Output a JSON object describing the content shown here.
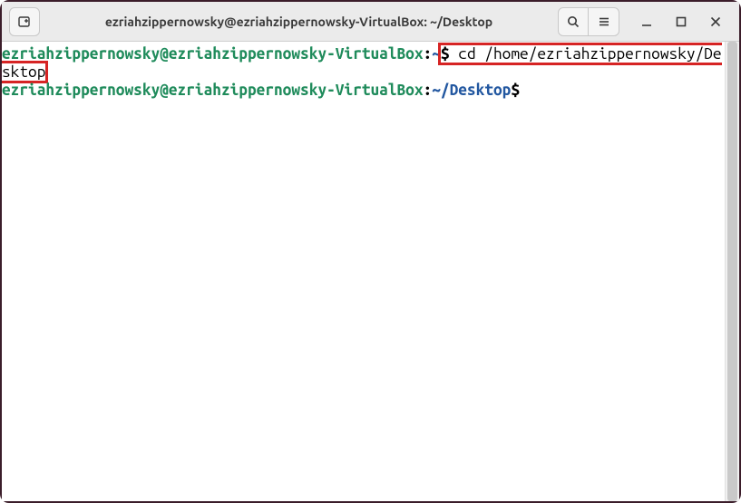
{
  "window": {
    "title": "ezriahzippernowsky@ezriahzippernowsky-VirtualBox: ~/Desktop"
  },
  "terminal": {
    "lines": [
      {
        "segments": [
          {
            "cls": "prompt-user",
            "text": "ezriahzippernowsky@ezriahzippernowsky-VirtualBox"
          },
          {
            "cls": "prompt-colon",
            "text": ":"
          },
          {
            "cls": "prompt-path",
            "text": "~"
          },
          {
            "cls": "prompt-dollar",
            "text": "$"
          },
          {
            "cls": "cmd",
            "text": " cd /home/ezriahzippernowsky/Desktop"
          }
        ],
        "highlightCmd": true
      },
      {
        "segments": [
          {
            "cls": "prompt-user",
            "text": "ezriahzippernowsky@ezriahzippernowsky-VirtualBox"
          },
          {
            "cls": "prompt-colon",
            "text": ":"
          },
          {
            "cls": "prompt-path",
            "text": "~/Desktop"
          },
          {
            "cls": "prompt-dollar",
            "text": "$"
          },
          {
            "cls": "cmd",
            "text": " "
          }
        ],
        "highlightCmd": false
      }
    ]
  }
}
